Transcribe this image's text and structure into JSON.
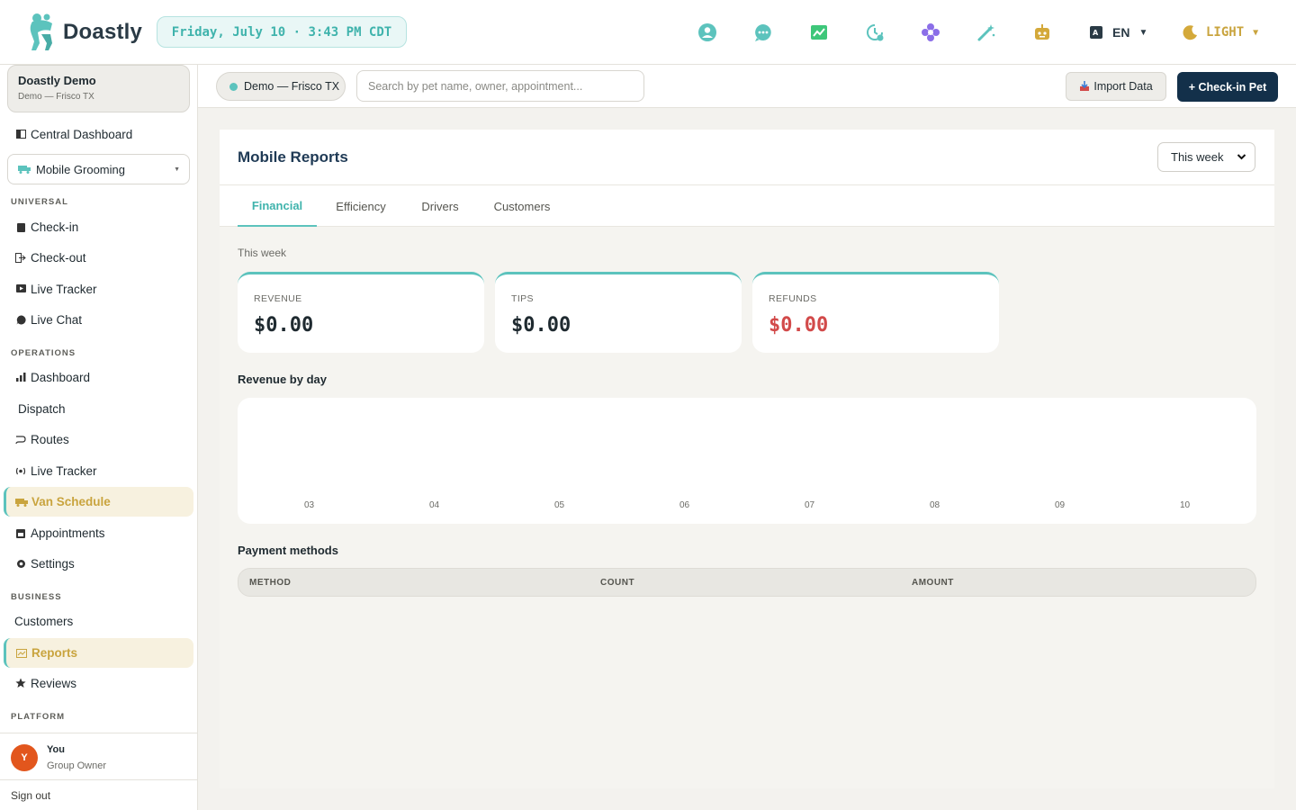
{
  "header": {
    "app_name": "Doastly",
    "datetime": "Friday, July 10 · 3:43 PM CDT",
    "icons": [
      "support-icon",
      "chat-icon",
      "analytics-icon",
      "history-icon",
      "flower-icon",
      "magic-wand-icon",
      "robot-icon"
    ],
    "language": "EN",
    "theme": "LIGHT"
  },
  "workspace": {
    "name": "Doastly Demo",
    "location": "Demo — Frisco TX"
  },
  "sidebar": {
    "central_dashboard": "Central Dashboard",
    "module": "Mobile Grooming",
    "sections": {
      "universal": "UNIVERSAL",
      "operations": "OPERATIONS",
      "business": "BUSINESS",
      "platform": "PLATFORM"
    },
    "universal_items": [
      "Check-in",
      "Check-out",
      "Live Tracker",
      "Live Chat"
    ],
    "operations_items": [
      "Dashboard",
      "Dispatch",
      "Routes",
      "Live Tracker",
      "Van Schedule",
      "Appointments",
      "Settings"
    ],
    "business_items": [
      "Customers",
      "Reports",
      "Reviews"
    ]
  },
  "user": {
    "initial": "Y",
    "name": "You",
    "role": "Group Owner",
    "signout": "Sign out"
  },
  "subheader": {
    "location": "Demo — Frisco TX",
    "search_placeholder": "Search by pet name, owner, appointment...",
    "import_label": "Import Data",
    "checkin_label": "+ Check-in Pet"
  },
  "page": {
    "title": "Mobile Reports",
    "range": "This week",
    "tabs": [
      "Financial",
      "Efficiency",
      "Drivers",
      "Customers"
    ],
    "active_tab": "Financial",
    "period_label": "This week",
    "stats": [
      {
        "label": "REVENUE",
        "value": "$0.00"
      },
      {
        "label": "TIPS",
        "value": "$0.00"
      },
      {
        "label": "REFUNDS",
        "value": "$0.00"
      }
    ],
    "revenue_title": "Revenue by day",
    "payment_title": "Payment methods",
    "payment_columns": [
      "METHOD",
      "COUNT",
      "AMOUNT"
    ]
  },
  "colors": {
    "accent": "#5cc3bd",
    "nav_active": "#c9a43e",
    "primary_button": "#13304a",
    "negative": "#d24a4a"
  },
  "chart_data": {
    "type": "bar",
    "categories": [
      "03",
      "04",
      "05",
      "06",
      "07",
      "08",
      "09",
      "10"
    ],
    "values": [
      0,
      0,
      0,
      0,
      0,
      0,
      0,
      0
    ],
    "title": "Revenue by day",
    "xlabel": "",
    "ylabel": "",
    "grid": false
  }
}
